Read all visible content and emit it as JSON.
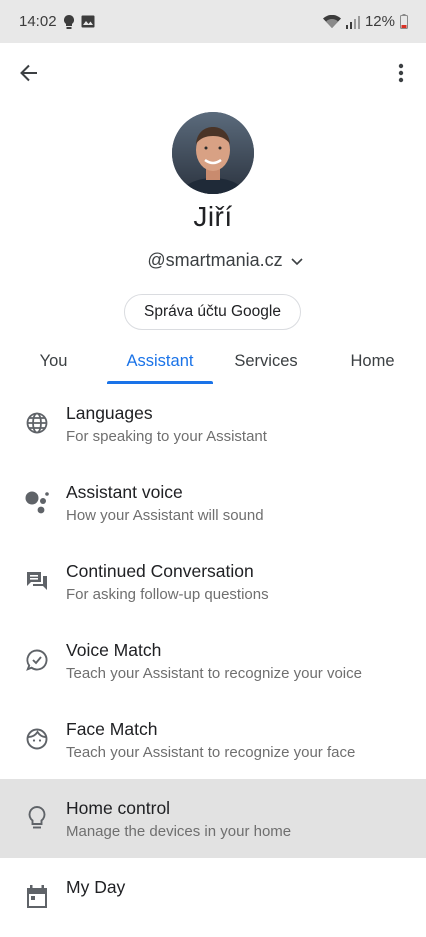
{
  "status_bar": {
    "time": "14:02",
    "battery": "12%",
    "icons": [
      "bulb-icon",
      "image-icon",
      "wifi-icon",
      "signal-icon",
      "battery-icon"
    ]
  },
  "app_bar": {
    "icons": [
      "back-arrow-icon",
      "more-vert-icon"
    ]
  },
  "profile": {
    "name": "Jiří",
    "account": "@smartmania.cz",
    "manage_label": "Správa účtu Google"
  },
  "tabs": [
    {
      "label": "You",
      "active": false
    },
    {
      "label": "Assistant",
      "active": true
    },
    {
      "label": "Services",
      "active": false
    },
    {
      "label": "Home",
      "active": false
    }
  ],
  "items": [
    {
      "icon": "globe-icon",
      "title": "Languages",
      "subtitle": "For speaking to your Assistant"
    },
    {
      "icon": "assistant-dots-icon",
      "title": "Assistant voice",
      "subtitle": "How your Assistant will sound"
    },
    {
      "icon": "chat-bubbles-icon",
      "title": "Continued Conversation",
      "subtitle": "For asking follow-up questions"
    },
    {
      "icon": "voice-match-icon",
      "title": "Voice Match",
      "subtitle": "Teach your Assistant to recognize your voice"
    },
    {
      "icon": "face-icon",
      "title": "Face Match",
      "subtitle": "Teach your Assistant to recognize your face"
    },
    {
      "icon": "lightbulb-icon",
      "title": "Home control",
      "subtitle": "Manage the devices in your home",
      "highlighted": true
    },
    {
      "icon": "calendar-icon",
      "title": "My Day",
      "subtitle": ""
    }
  ],
  "colors": {
    "accent": "#1a73e8",
    "status_bar_bg": "#e8e8e8",
    "highlight_bg": "#e2e2e2",
    "battery_low": "#d93025"
  }
}
